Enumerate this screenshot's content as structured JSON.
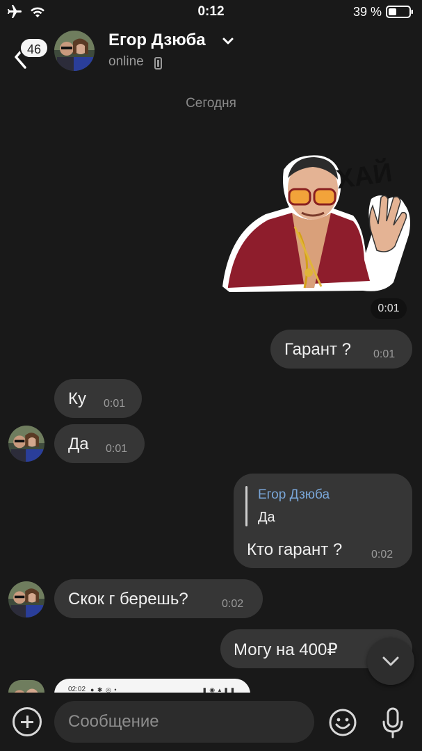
{
  "status_bar": {
    "time": "0:12",
    "battery_percent": "39 %"
  },
  "header": {
    "unread_count": "46",
    "name": "Егор Дзюба",
    "status": "online"
  },
  "chat": {
    "date_separator": "Сегодня",
    "sticker": {
      "caption": "ХАЙ",
      "time": "0:01"
    },
    "messages": [
      {
        "direction": "outgoing",
        "text": "Гарант ?",
        "time": "0:01"
      },
      {
        "direction": "incoming",
        "text": "Ку",
        "time": "0:01"
      },
      {
        "direction": "incoming",
        "text": "Да",
        "time": "0:01"
      },
      {
        "direction": "outgoing",
        "reply_to_name": "Егор Дзюба",
        "reply_to_text": "Да",
        "text": "Кто гарант ?",
        "time": "0:02"
      },
      {
        "direction": "incoming",
        "text": "Скок г берешь?",
        "time": "0:02"
      },
      {
        "direction": "outgoing",
        "text": "Могу на 400₽",
        "time": ""
      }
    ],
    "screenshot_preview": {
      "time": "02:02"
    }
  },
  "composer": {
    "placeholder": "Сообщение"
  },
  "icons": {
    "airplane": "airplane-icon",
    "wifi": "wifi-icon",
    "battery": "battery-icon",
    "back": "chevron-left-icon",
    "dropdown": "chevron-down-icon",
    "phone": "phone-icon",
    "scroll_down": "chevron-down-icon",
    "attach": "plus-circle-icon",
    "emoji": "emoji-icon",
    "mic": "microphone-icon"
  },
  "colors": {
    "background": "#191919",
    "bubble": "#363636",
    "reply_name": "#7aa7d9"
  }
}
